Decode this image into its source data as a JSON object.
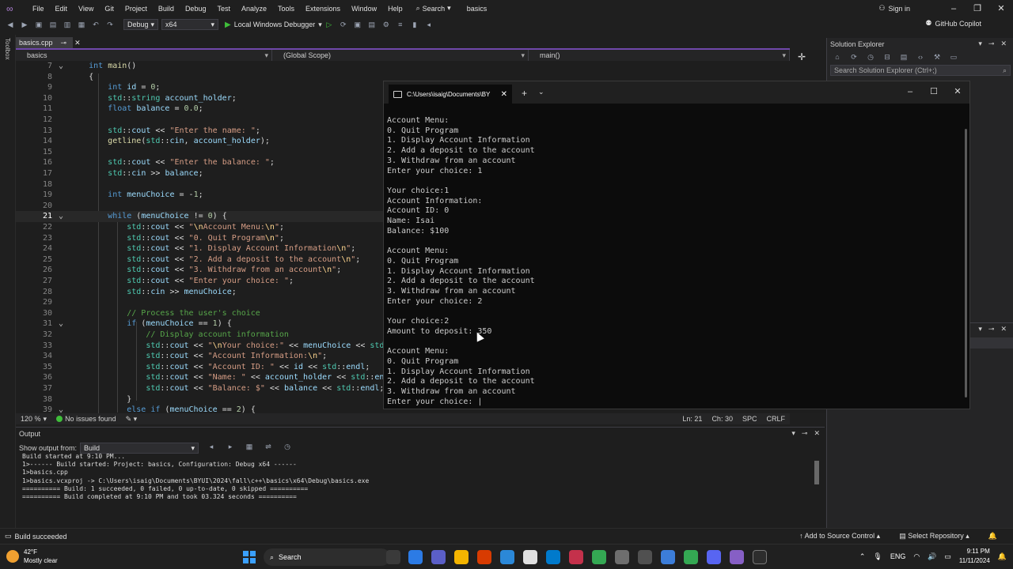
{
  "menubar": {
    "items": [
      "File",
      "Edit",
      "View",
      "Git",
      "Project",
      "Build",
      "Debug",
      "Test",
      "Analyze",
      "Tools",
      "Extensions",
      "Window",
      "Help"
    ],
    "search_label": "Search",
    "project_name": "basics",
    "sign_in": "Sign in"
  },
  "toolbar": {
    "config": "Debug",
    "platform": "x64",
    "run_label": "Local Windows Debugger",
    "copilot": "GitHub Copilot"
  },
  "toolbox_label": "Toolbox",
  "editor": {
    "tab_label": "basics.cpp",
    "nav_project": "basics",
    "nav_scope": "(Global Scope)",
    "nav_member": "main()",
    "zoom": "120 %",
    "issues": "No issues found",
    "ln": "Ln: 21",
    "ch": "Ch: 30",
    "spc": "SPC",
    "crlf": "CRLF",
    "lines": [
      {
        "n": "7",
        "fold": "⌄",
        "indent": 0,
        "html": "<span class='kw'>int</span> <span class='fn'>main</span>()"
      },
      {
        "n": "8",
        "fold": "",
        "indent": 0,
        "html": "{"
      },
      {
        "n": "9",
        "fold": "",
        "indent": 1,
        "html": "<span class='kw'>int</span> <span class='var'>id</span> = <span class='num'>0</span>;"
      },
      {
        "n": "10",
        "fold": "",
        "indent": 1,
        "html": "<span class='ns'>std</span>::<span class='ns'>string</span> <span class='var'>account_holder</span>;"
      },
      {
        "n": "11",
        "fold": "",
        "indent": 1,
        "html": "<span class='kw'>float</span> <span class='var'>balance</span> = <span class='num'>0.0</span>;"
      },
      {
        "n": "12",
        "fold": "",
        "indent": 0,
        "html": ""
      },
      {
        "n": "13",
        "fold": "",
        "indent": 1,
        "html": "<span class='ns'>std</span>::<span class='var'>cout</span> &lt;&lt; <span class='str'>\"Enter the name: \"</span>;"
      },
      {
        "n": "14",
        "fold": "",
        "indent": 1,
        "html": "<span class='fn'>getline</span>(<span class='ns'>std</span>::<span class='var'>cin</span>, <span class='var'>account_holder</span>);"
      },
      {
        "n": "15",
        "fold": "",
        "indent": 0,
        "html": ""
      },
      {
        "n": "16",
        "fold": "",
        "indent": 1,
        "html": "<span class='ns'>std</span>::<span class='var'>cout</span> &lt;&lt; <span class='str'>\"Enter the balance: \"</span>;"
      },
      {
        "n": "17",
        "fold": "",
        "indent": 1,
        "html": "<span class='ns'>std</span>::<span class='var'>cin</span> &gt;&gt; <span class='var'>balance</span>;"
      },
      {
        "n": "18",
        "fold": "",
        "indent": 0,
        "html": ""
      },
      {
        "n": "19",
        "fold": "",
        "indent": 1,
        "html": "<span class='kw'>int</span> <span class='var'>menuChoice</span> = -<span class='num'>1</span>;"
      },
      {
        "n": "20",
        "fold": "",
        "indent": 0,
        "html": ""
      },
      {
        "n": "21",
        "fold": "⌄",
        "indent": 1,
        "current": true,
        "html": "<span class='kw'>while</span> (<span class='var'>menuChoice</span> != <span class='num'>0</span>) {"
      },
      {
        "n": "22",
        "fold": "",
        "indent": 2,
        "html": "<span class='ns'>std</span>::<span class='var'>cout</span> &lt;&lt; <span class='str'>\"<span class='esc'>\\n</span>Account Menu:<span class='esc'>\\n</span>\"</span>;"
      },
      {
        "n": "23",
        "fold": "",
        "indent": 2,
        "html": "<span class='ns'>std</span>::<span class='var'>cout</span> &lt;&lt; <span class='str'>\"0. Quit Program<span class='esc'>\\n</span>\"</span>;"
      },
      {
        "n": "24",
        "fold": "",
        "indent": 2,
        "html": "<span class='ns'>std</span>::<span class='var'>cout</span> &lt;&lt; <span class='str'>\"1. Display Account Information<span class='esc'>\\n</span>\"</span>;"
      },
      {
        "n": "25",
        "fold": "",
        "indent": 2,
        "html": "<span class='ns'>std</span>::<span class='var'>cout</span> &lt;&lt; <span class='str'>\"2. Add a deposit to the account<span class='esc'>\\n</span>\"</span>;"
      },
      {
        "n": "26",
        "fold": "",
        "indent": 2,
        "html": "<span class='ns'>std</span>::<span class='var'>cout</span> &lt;&lt; <span class='str'>\"3. Withdraw from an account<span class='esc'>\\n</span>\"</span>;"
      },
      {
        "n": "27",
        "fold": "",
        "indent": 2,
        "html": "<span class='ns'>std</span>::<span class='var'>cout</span> &lt;&lt; <span class='str'>\"Enter your choice: \"</span>;"
      },
      {
        "n": "28",
        "fold": "",
        "indent": 2,
        "html": "<span class='ns'>std</span>::<span class='var'>cin</span> &gt;&gt; <span class='var'>menuChoice</span>;"
      },
      {
        "n": "29",
        "fold": "",
        "indent": 0,
        "html": ""
      },
      {
        "n": "30",
        "fold": "",
        "indent": 2,
        "html": "<span class='cmt'>// Process the user's choice</span>"
      },
      {
        "n": "31",
        "fold": "⌄",
        "indent": 2,
        "html": "<span class='kw'>if</span> (<span class='var'>menuChoice</span> == <span class='num'>1</span>) {"
      },
      {
        "n": "32",
        "fold": "",
        "indent": 3,
        "html": "<span class='cmt'>// Display account information</span>"
      },
      {
        "n": "33",
        "fold": "",
        "indent": 3,
        "html": "<span class='ns'>std</span>::<span class='var'>cout</span> &lt;&lt; <span class='str'>\"<span class='esc'>\\n</span>Your choice:\"</span> &lt;&lt; <span class='var'>menuChoice</span> &lt;&lt; <span class='ns'>std</span>"
      },
      {
        "n": "34",
        "fold": "",
        "indent": 3,
        "html": "<span class='ns'>std</span>::<span class='var'>cout</span> &lt;&lt; <span class='str'>\"Account Information:<span class='esc'>\\n</span>\"</span>;"
      },
      {
        "n": "35",
        "fold": "",
        "indent": 3,
        "html": "<span class='ns'>std</span>::<span class='var'>cout</span> &lt;&lt; <span class='str'>\"Account ID: \"</span> &lt;&lt; <span class='var'>id</span> &lt;&lt; <span class='ns'>std</span>::<span class='var'>endl</span>;"
      },
      {
        "n": "36",
        "fold": "",
        "indent": 3,
        "html": "<span class='ns'>std</span>::<span class='var'>cout</span> &lt;&lt; <span class='str'>\"Name: \"</span> &lt;&lt; <span class='var'>account_holder</span> &lt;&lt; <span class='ns'>std</span>::<span class='var'>endl</span>;"
      },
      {
        "n": "37",
        "fold": "",
        "indent": 3,
        "html": "<span class='ns'>std</span>::<span class='var'>cout</span> &lt;&lt; <span class='str'>\"Balance: $\"</span> &lt;&lt; <span class='var'>balance</span> &lt;&lt; <span class='ns'>std</span>::<span class='var'>endl</span>;"
      },
      {
        "n": "38",
        "fold": "",
        "indent": 2,
        "html": "}"
      },
      {
        "n": "39",
        "fold": "⌄",
        "indent": 2,
        "html": "<span class='kw'>else if</span> (<span class='var'>menuChoice</span> == <span class='num'>2</span>) {"
      }
    ]
  },
  "terminal": {
    "tab_title": "C:\\Users\\isaig\\Documents\\BY",
    "lines": [
      "Account Menu:",
      "0. Quit Program",
      "1. Display Account Information",
      "2. Add a deposit to the account",
      "3. Withdraw from an account",
      "Enter your choice: 1",
      "",
      "Your choice:1",
      "Account Information:",
      "Account ID: 0",
      "Name: Isai",
      "Balance: $100",
      "",
      "Account Menu:",
      "0. Quit Program",
      "1. Display Account Information",
      "2. Add a deposit to the account",
      "3. Withdraw from an account",
      "Enter your choice: 2",
      "",
      "Your choice:2",
      "Amount to deposit: 350",
      "",
      "Account Menu:",
      "0. Quit Program",
      "1. Display Account Information",
      "2. Add a deposit to the account",
      "3. Withdraw from an account",
      "Enter your choice: |"
    ]
  },
  "solution_explorer": {
    "title": "Solution Explorer",
    "search_placeholder": "Search Solution Explorer (Ctrl+;)"
  },
  "output": {
    "title": "Output",
    "show_from_label": "Show output from:",
    "source": "Build",
    "lines": [
      "Build started at 9:10 PM...",
      "1>------ Build started: Project: basics, Configuration: Debug x64 ------",
      "1>basics.cpp",
      "1>basics.vcxproj -> C:\\Users\\isaig\\Documents\\BYUI\\2024\\fall\\c++\\basics\\x64\\Debug\\basics.exe",
      "========== Build: 1 succeeded, 0 failed, 0 up-to-date, 0 skipped ==========",
      "========== Build completed at 9:10 PM and took 03.324 seconds =========="
    ]
  },
  "statusbar": {
    "build_status": "Build succeeded",
    "source_control": "Add to Source Control",
    "repository": "Select Repository"
  },
  "taskbar": {
    "temperature": "42°F",
    "weather": "Mostly clear",
    "search": "Search",
    "lang": "ENG",
    "time": "9:11 PM",
    "date": "11/11/2024"
  }
}
